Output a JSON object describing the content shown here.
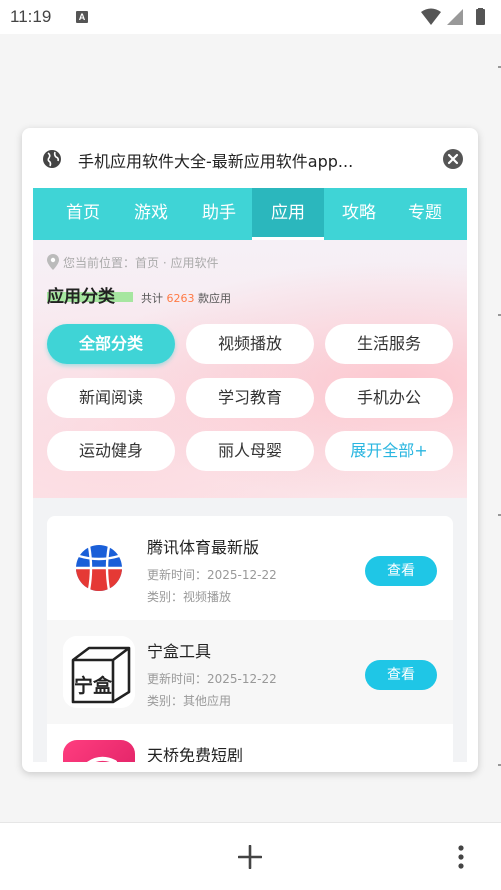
{
  "status_bar": {
    "time": "11:19",
    "notification_letter": "A"
  },
  "dialog": {
    "title": "手机应用软件大全-最新应用软件app...",
    "icons": {
      "leading": "globe-icon",
      "trailing": "close-icon"
    }
  },
  "site": {
    "nav": [
      {
        "label": "首页",
        "active": false
      },
      {
        "label": "游戏",
        "active": false
      },
      {
        "label": "助手",
        "active": false
      },
      {
        "label": "应用",
        "active": true
      },
      {
        "label": "攻略",
        "active": false
      },
      {
        "label": "专题",
        "active": false
      }
    ],
    "breadcrumb": "您当前位置：首页 · 应用软件",
    "category": {
      "title": "应用分类",
      "count_prefix": "共计",
      "count": "6263",
      "count_suffix": "款应用",
      "chips": [
        {
          "label": "全部分类",
          "active": true
        },
        {
          "label": "视频播放",
          "active": false
        },
        {
          "label": "生活服务",
          "active": false
        },
        {
          "label": "新闻阅读",
          "active": false
        },
        {
          "label": "学习教育",
          "active": false
        },
        {
          "label": "手机办公",
          "active": false
        },
        {
          "label": "运动健身",
          "active": false
        },
        {
          "label": "丽人母婴",
          "active": false
        },
        {
          "label": "展开全部+",
          "active": false
        }
      ]
    },
    "apps": [
      {
        "name": "腾讯体育最新版",
        "updated": "更新时间：2025-12-22",
        "category": "类别：视频播放",
        "button": "查看",
        "icon": "tencent-sports-logo"
      },
      {
        "name": "宁盒工具",
        "updated": "更新时间：2025-12-22",
        "category": "类别：其他应用",
        "button": "查看",
        "icon": "ninghe-logo",
        "icon_text": "宁盒"
      },
      {
        "name": "天桥免费短剧",
        "icon": "tianqiao-logo"
      }
    ]
  },
  "colors": {
    "accent": "#3fd4d6",
    "nav_active": "#2bb7bd",
    "button": "#1fc6e6",
    "count": "#ff7a45"
  }
}
